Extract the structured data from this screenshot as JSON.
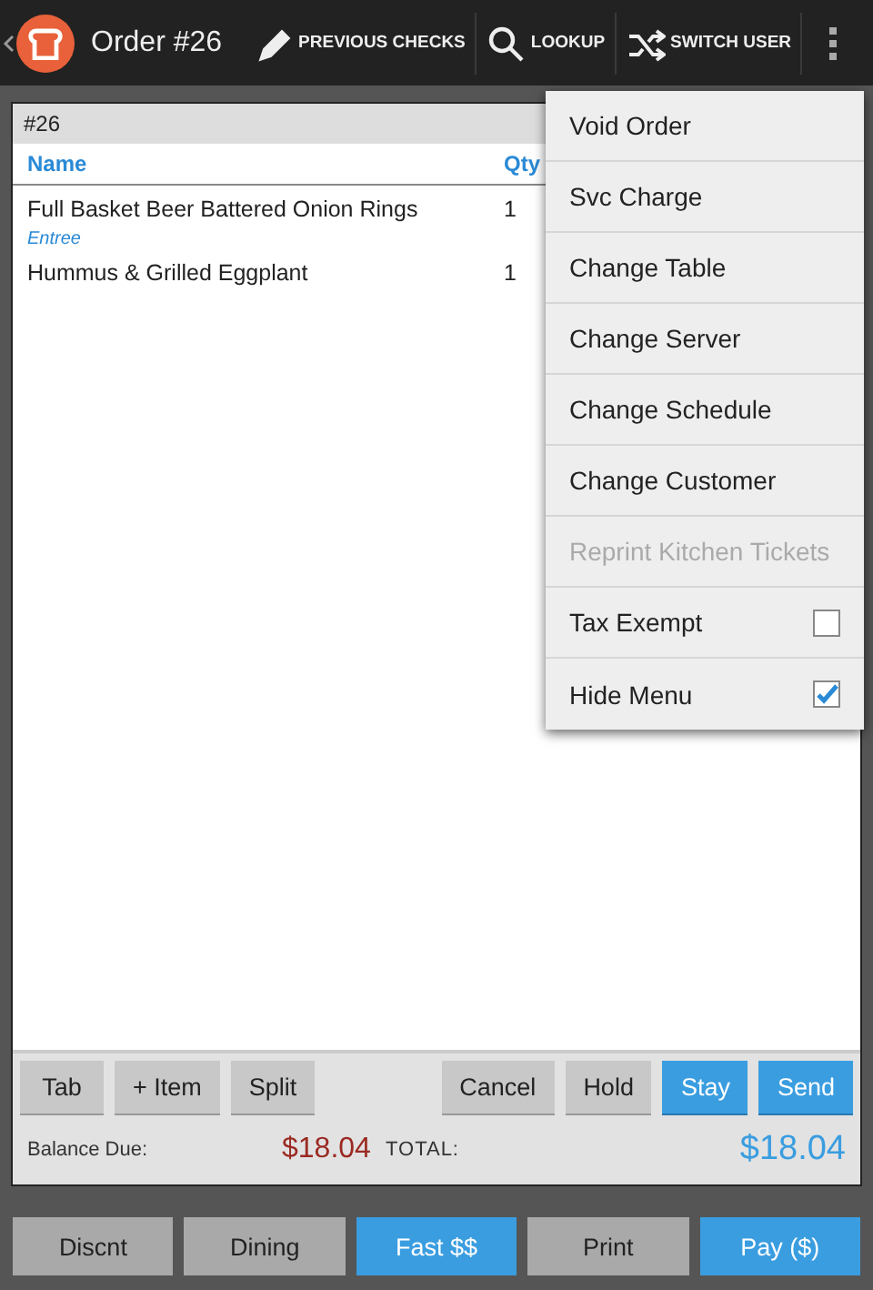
{
  "top_bar": {
    "title": "Order #26",
    "actions": [
      {
        "label": "PREVIOUS CHECKS"
      },
      {
        "label": "LOOKUP"
      },
      {
        "label": "SWITCH USER"
      }
    ]
  },
  "order": {
    "number": "#26",
    "columns": [
      "Name",
      "Qty"
    ],
    "rows": [
      {
        "kind": "item",
        "name": "Full Basket Beer Battered Onion Rings",
        "qty": "1"
      },
      {
        "kind": "category",
        "name": "Entree"
      },
      {
        "kind": "item",
        "name": "Hummus & Grilled Eggplant",
        "qty": "1"
      }
    ],
    "left_buttons": [
      {
        "label": "Tab",
        "primary": false
      },
      {
        "label": "+ Item",
        "primary": false
      },
      {
        "label": "Split",
        "primary": false
      }
    ],
    "right_buttons": [
      {
        "label": "Cancel",
        "primary": false
      },
      {
        "label": "Hold",
        "primary": false
      },
      {
        "label": "Stay",
        "primary": true
      },
      {
        "label": "Send",
        "primary": true
      }
    ],
    "balance_label": "Balance Due:",
    "balance": "$18.04",
    "total_label": "TOTAL:",
    "total": "$18.04"
  },
  "bottom_buttons": [
    {
      "label": "Discnt",
      "primary": false
    },
    {
      "label": "Dining",
      "primary": false
    },
    {
      "label": "Fast $$",
      "primary": true
    },
    {
      "label": "Print",
      "primary": false
    },
    {
      "label": "Pay ($)",
      "primary": true
    }
  ],
  "menu": [
    {
      "kind": "action",
      "label": "Void Order",
      "disabled": false
    },
    {
      "kind": "action",
      "label": "Svc Charge",
      "disabled": false
    },
    {
      "kind": "action",
      "label": "Change Table",
      "disabled": false
    },
    {
      "kind": "action",
      "label": "Change Server",
      "disabled": false
    },
    {
      "kind": "action",
      "label": "Change Schedule",
      "disabled": false
    },
    {
      "kind": "action",
      "label": "Change Customer",
      "disabled": false
    },
    {
      "kind": "action",
      "label": "Reprint Kitchen Tickets",
      "disabled": true
    },
    {
      "kind": "checkbox",
      "label": "Tax Exempt",
      "disabled": false,
      "checked": false
    },
    {
      "kind": "checkbox",
      "label": "Hide Menu",
      "disabled": false,
      "checked": true
    }
  ]
}
